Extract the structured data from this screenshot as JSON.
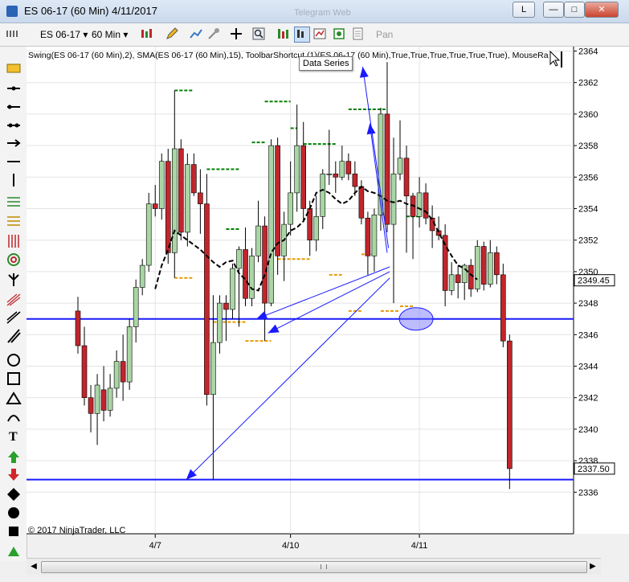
{
  "window": {
    "title": "ES 06-17 (60 Min)  4/11/2017",
    "ghost_text": "Telegram Web"
  },
  "window_buttons": {
    "min": "—",
    "max": "□",
    "close": "✕",
    "l": "L"
  },
  "toolbar": {
    "instrument": "ES 06-17",
    "interval": "60 Min",
    "pan": "Pan"
  },
  "tooltip": "Data Series",
  "indicator_label": "Swing(ES 06-17 (60 Min),2), SMA(ES 06-17 (60 Min),15), ToolbarShortcut (1)(ES 06-17 (60 Min),True,True,True,True,True,True), MouseRa",
  "copyright": "© 2017 NinjaTrader, LLC",
  "colors": {
    "up": "#a9d6a4",
    "down": "#c0262b",
    "sma": "#000000",
    "swing_high": "#008000",
    "swing_low": "#e89a00",
    "annot": "#1a1aff"
  },
  "chart_data": {
    "type": "candlestick",
    "ylim": [
      2335,
      2365
    ],
    "y_ticks": [
      2336,
      2338,
      2340,
      2342,
      2344,
      2346,
      2348,
      2350,
      2352,
      2354,
      2356,
      2358,
      2360,
      2362,
      2364
    ],
    "x_tick_labels": [
      {
        "label": "4/7",
        "index": 12
      },
      {
        "label": "4/10",
        "index": 33
      },
      {
        "label": "4/11",
        "index": 53
      }
    ],
    "price_markers": [
      {
        "value": 2349.45,
        "label": "2349.45"
      },
      {
        "value": 2337.5,
        "label": "2337.50"
      }
    ],
    "candles": [
      [
        2347.5,
        2348.4,
        2344.8,
        2345.3
      ],
      [
        2345.3,
        2346.5,
        2341.5,
        2342.0
      ],
      [
        2342.0,
        2342.8,
        2339.8,
        2341.0
      ],
      [
        2341.0,
        2343.5,
        2339.0,
        2342.8
      ],
      [
        2342.5,
        2344.0,
        2340.5,
        2341.2
      ],
      [
        2341.2,
        2343.5,
        2340.8,
        2342.6
      ],
      [
        2342.6,
        2345.0,
        2342.0,
        2344.3
      ],
      [
        2344.3,
        2346.0,
        2341.8,
        2343.0
      ],
      [
        2343.0,
        2347.0,
        2342.5,
        2346.5
      ],
      [
        2346.5,
        2349.5,
        2345.5,
        2349.0
      ],
      [
        2349.0,
        2350.8,
        2348.5,
        2350.4
      ],
      [
        2350.4,
        2355.0,
        2350.0,
        2354.3
      ],
      [
        2354.3,
        2355.5,
        2353.5,
        2354.0
      ],
      [
        2354.0,
        2357.5,
        2353.3,
        2357.0
      ],
      [
        2357.0,
        2357.8,
        2350.5,
        2351.2
      ],
      [
        2351.2,
        2361.5,
        2349.6,
        2357.8
      ],
      [
        2357.8,
        2358.4,
        2352.0,
        2352.5
      ],
      [
        2352.5,
        2357.5,
        2351.6,
        2356.8
      ],
      [
        2356.8,
        2357.5,
        2354.8,
        2355.0
      ],
      [
        2355.0,
        2356.5,
        2352.4,
        2354.3
      ],
      [
        2354.3,
        2356.2,
        2341.5,
        2342.2
      ],
      [
        2342.2,
        2348.5,
        2336.8,
        2345.5
      ],
      [
        2345.5,
        2348.5,
        2344.8,
        2348.0
      ],
      [
        2348.0,
        2348.5,
        2345.6,
        2347.6
      ],
      [
        2347.6,
        2350.5,
        2347.0,
        2350.2
      ],
      [
        2350.2,
        2351.6,
        2346.5,
        2351.4
      ],
      [
        2351.4,
        2352.8,
        2347.8,
        2348.3
      ],
      [
        2348.3,
        2351.5,
        2347.8,
        2351.0
      ],
      [
        2351.0,
        2354.5,
        2350.6,
        2352.9
      ],
      [
        2352.9,
        2353.5,
        2345.6,
        2348.0
      ],
      [
        2348.0,
        2358.4,
        2347.8,
        2358.0
      ],
      [
        2358.0,
        2358.5,
        2349.8,
        2351.0
      ],
      [
        2351.0,
        2353.8,
        2349.4,
        2353.0
      ],
      [
        2353.0,
        2357.0,
        2352.3,
        2355.0
      ],
      [
        2355.0,
        2360.6,
        2353.8,
        2358.0
      ],
      [
        2358.0,
        2359.5,
        2353.2,
        2354.0
      ],
      [
        2354.0,
        2354.5,
        2351.0,
        2352.0
      ],
      [
        2352.0,
        2354.8,
        2351.3,
        2353.5
      ],
      [
        2353.5,
        2356.5,
        2352.7,
        2356.2
      ],
      [
        2356.2,
        2359.0,
        2355.5,
        2356.2
      ],
      [
        2356.2,
        2357.0,
        2355.0,
        2356.0
      ],
      [
        2356.0,
        2358.0,
        2355.8,
        2357.0
      ],
      [
        2357.0,
        2357.5,
        2355.8,
        2356.2
      ],
      [
        2356.2,
        2357.0,
        2354.8,
        2355.4
      ],
      [
        2355.4,
        2355.8,
        2353.0,
        2353.4
      ],
      [
        2353.4,
        2353.8,
        2349.8,
        2351.0
      ],
      [
        2351.0,
        2354.0,
        2350.0,
        2353.6
      ],
      [
        2353.6,
        2360.4,
        2352.6,
        2360.0
      ],
      [
        2360.0,
        2363.3,
        2352.5,
        2353.0
      ],
      [
        2353.0,
        2358.5,
        2348.0,
        2356.2
      ],
      [
        2356.2,
        2359.6,
        2355.8,
        2357.2
      ],
      [
        2357.2,
        2358.0,
        2351.2,
        2354.8
      ],
      [
        2354.8,
        2355.0,
        2350.8,
        2353.5
      ],
      [
        2353.5,
        2356.0,
        2352.8,
        2355.0
      ],
      [
        2355.0,
        2355.6,
        2353.0,
        2353.4
      ],
      [
        2353.4,
        2354.2,
        2351.5,
        2352.6
      ],
      [
        2352.6,
        2353.5,
        2352.0,
        2352.3
      ],
      [
        2352.3,
        2353.0,
        2347.8,
        2348.8
      ],
      [
        2348.8,
        2350.6,
        2348.5,
        2349.8
      ],
      [
        2349.8,
        2350.4,
        2348.3,
        2349.3
      ],
      [
        2349.3,
        2350.5,
        2348.2,
        2350.4
      ],
      [
        2350.4,
        2350.8,
        2348.4,
        2348.9
      ],
      [
        2348.9,
        2352.0,
        2348.7,
        2351.6
      ],
      [
        2351.6,
        2351.9,
        2348.8,
        2349.2
      ],
      [
        2349.2,
        2352.0,
        2349.0,
        2351.2
      ],
      [
        2351.2,
        2351.6,
        2349.2,
        2349.8
      ],
      [
        2349.8,
        2350.5,
        2345.2,
        2345.6
      ],
      [
        2345.6,
        2346.0,
        2336.2,
        2337.5
      ]
    ],
    "sma": [
      [
        12,
        2348.9
      ],
      [
        13,
        2350.4
      ],
      [
        14,
        2351.4
      ],
      [
        15,
        2352.6
      ],
      [
        16,
        2352.3
      ],
      [
        17,
        2352.0
      ],
      [
        18,
        2351.7
      ],
      [
        19,
        2351.4
      ],
      [
        20,
        2351.0
      ],
      [
        21,
        2350.6
      ],
      [
        22,
        2350.3
      ],
      [
        23,
        2350.6
      ],
      [
        24,
        2350.7
      ],
      [
        25,
        2349.9
      ],
      [
        26,
        2349.5
      ],
      [
        27,
        2348.9
      ],
      [
        28,
        2348.8
      ],
      [
        29,
        2349.8
      ],
      [
        30,
        2351.2
      ],
      [
        31,
        2351.8
      ],
      [
        32,
        2352.0
      ],
      [
        33,
        2352.6
      ],
      [
        34,
        2352.8
      ],
      [
        35,
        2353.2
      ],
      [
        36,
        2354.0
      ],
      [
        37,
        2355.0
      ],
      [
        38,
        2355.2
      ],
      [
        39,
        2355.0
      ],
      [
        40,
        2354.6
      ],
      [
        41,
        2354.3
      ],
      [
        42,
        2354.5
      ],
      [
        43,
        2355.0
      ],
      [
        44,
        2355.4
      ],
      [
        45,
        2355.1
      ],
      [
        46,
        2355.0
      ],
      [
        47,
        2354.8
      ],
      [
        48,
        2354.5
      ],
      [
        49,
        2354.4
      ],
      [
        50,
        2354.5
      ],
      [
        51,
        2354.3
      ],
      [
        52,
        2354.2
      ],
      [
        53,
        2354.0
      ],
      [
        54,
        2353.8
      ],
      [
        55,
        2353.3
      ],
      [
        56,
        2352.5
      ],
      [
        57,
        2351.7
      ],
      [
        58,
        2351.0
      ],
      [
        59,
        2350.4
      ],
      [
        60,
        2350.2
      ],
      [
        61,
        2349.8
      ],
      [
        62,
        2349.5
      ]
    ],
    "swing_highs": [
      {
        "value": 2361.5,
        "from": 15,
        "to": 18
      },
      {
        "value": 2356.5,
        "from": 20,
        "to": 25
      },
      {
        "value": 2352.7,
        "from": 23,
        "to": 25
      },
      {
        "value": 2358.2,
        "from": 27,
        "to": 29
      },
      {
        "value": 2360.8,
        "from": 29,
        "to": 33
      },
      {
        "value": 2359.1,
        "from": 33,
        "to": 34
      },
      {
        "value": 2358.1,
        "from": 35,
        "to": 40
      },
      {
        "value": 2363.3,
        "from": 40,
        "to": 42
      },
      {
        "value": 2360.3,
        "from": 42,
        "to": 48
      },
      {
        "value": 2353.5,
        "from": 51,
        "to": 53
      }
    ],
    "swing_lows": [
      {
        "value": 2349.6,
        "from": 15,
        "to": 18
      },
      {
        "value": 2346.8,
        "from": 21,
        "to": 26
      },
      {
        "value": 2345.6,
        "from": 26,
        "to": 30
      },
      {
        "value": 2350.8,
        "from": 31,
        "to": 36
      },
      {
        "value": 2349.8,
        "from": 39,
        "to": 41
      },
      {
        "value": 2347.5,
        "from": 42,
        "to": 44
      },
      {
        "value": 2351.1,
        "from": 44,
        "to": 46
      },
      {
        "value": 2347.5,
        "from": 47,
        "to": 50
      },
      {
        "value": 2347.8,
        "from": 50,
        "to": 52
      }
    ],
    "h_lines": [
      2347.0,
      2336.8
    ],
    "arrows": [
      {
        "from": [
          48.2,
          2351.5
        ],
        "to": [
          44.2,
          2363.0
        ]
      },
      {
        "from": [
          48.0,
          2351.2
        ],
        "to": [
          45.3,
          2359.4
        ]
      },
      {
        "from": [
          48.4,
          2350.3
        ],
        "to": [
          27.7,
          2347.0
        ]
      },
      {
        "from": [
          48.4,
          2350.0
        ],
        "to": [
          29.5,
          2346.1
        ]
      },
      {
        "from": [
          48.4,
          2349.6
        ],
        "to": [
          16.8,
          2336.8
        ]
      }
    ],
    "ellipse": {
      "x": 52.5,
      "y": 2347.0
    }
  }
}
